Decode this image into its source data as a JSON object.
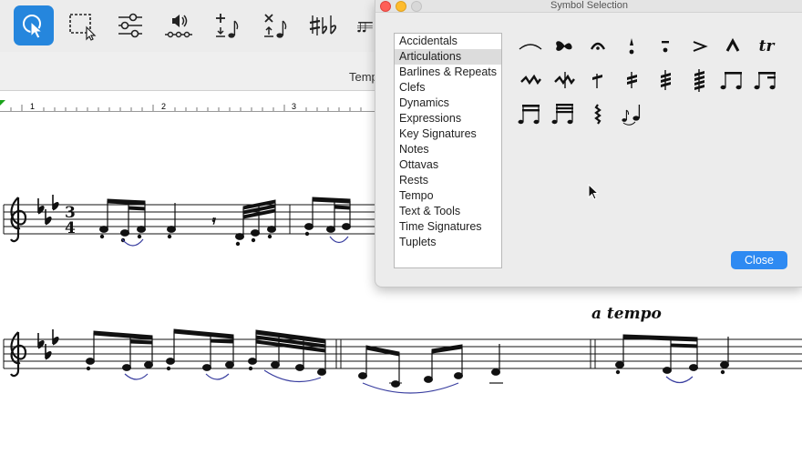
{
  "toolbar": {
    "tools": [
      {
        "name": "selection-tool",
        "icon": "arrow-pointer-icon",
        "active": true
      },
      {
        "name": "marquee-tool",
        "icon": "dashed-marquee-icon",
        "active": false
      },
      {
        "name": "mixer-tool",
        "icon": "sliders-icon",
        "active": false
      },
      {
        "name": "playback-tool",
        "icon": "speaker-icon",
        "active": false
      },
      {
        "name": "add-note-tool",
        "icon": "add-note-icon",
        "active": false
      },
      {
        "name": "delete-note-tool",
        "icon": "delete-note-icon",
        "active": false
      },
      {
        "name": "accidental-tool",
        "icon": "sharp-flat-icon",
        "active": false
      },
      {
        "name": "notes-tool",
        "icon": "notes-icon",
        "active": false
      }
    ]
  },
  "tempo_bar": {
    "label": "Tempo"
  },
  "ruler": {
    "marks": [
      "1",
      "2",
      "3"
    ]
  },
  "score": {
    "expression": "a tempo",
    "time_signature": [
      "3",
      "4"
    ]
  },
  "dialog": {
    "title": "Symbol Selection",
    "categories": [
      "Accidentals",
      "Articulations",
      "Barlines & Repeats",
      "Clefs",
      "Dynamics",
      "Expressions",
      "Key Signatures",
      "Notes",
      "Ottavas",
      "Rests",
      "Tempo",
      "Text & Tools",
      "Time Signatures",
      "Tuplets"
    ],
    "selected_category": "Articulations",
    "symbols": [
      {
        "name": "slur-symbol",
        "text": ""
      },
      {
        "name": "turn-symbol",
        "text": ""
      },
      {
        "name": "fermata-symbol",
        "text": ""
      },
      {
        "name": "staccatissimo-symbol",
        "text": ""
      },
      {
        "name": "tenuto-staccato-symbol",
        "text": ""
      },
      {
        "name": "accent-symbol",
        "text": ""
      },
      {
        "name": "marcato-symbol",
        "text": ""
      },
      {
        "name": "trill-symbol",
        "text": "tr"
      },
      {
        "name": "mordent-symbol",
        "text": ""
      },
      {
        "name": "inverted-mordent-symbol",
        "text": ""
      },
      {
        "name": "tremolo-one-symbol",
        "text": ""
      },
      {
        "name": "tremolo-two-symbol",
        "text": ""
      },
      {
        "name": "tremolo-three-symbol",
        "text": ""
      },
      {
        "name": "tremolo-four-symbol",
        "text": ""
      },
      {
        "name": "beamed-eighths-symbol",
        "text": ""
      },
      {
        "name": "beamed-eighth-sixteenth-symbol",
        "text": ""
      },
      {
        "name": "beamed-sixteenths-symbol",
        "text": ""
      },
      {
        "name": "beamed-thirtyseconds-symbol",
        "text": ""
      },
      {
        "name": "wavy-vertical-symbol",
        "text": ""
      },
      {
        "name": "grace-slur-symbol",
        "text": ""
      }
    ],
    "close_label": "Close"
  }
}
